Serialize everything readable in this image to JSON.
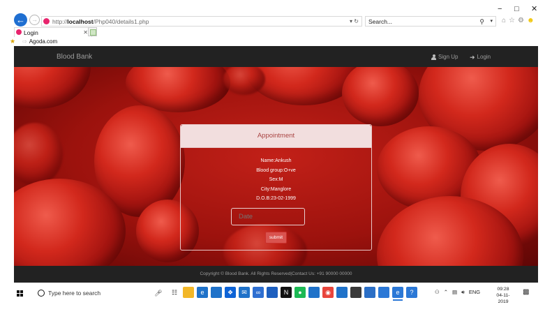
{
  "browser": {
    "url_prefix": "http://",
    "url_host": "localhost",
    "url_path": "/Php040/details1.php",
    "search_placeholder": "Search...",
    "tab_label": "Login",
    "favorites_link": "Agoda.com",
    "window_controls": [
      "−",
      "□",
      "✕"
    ]
  },
  "site": {
    "brand": "Blood Bank",
    "nav": {
      "signup": "Sign Up",
      "login": "Login"
    },
    "appointment": {
      "title": "Appointment",
      "details": {
        "name": "Name:Ankush",
        "blood_group": "Blood group:O+ve",
        "sex": "Sex:M",
        "city": "City:Manglore",
        "dob": "D.O.B:23-02-1999"
      },
      "date_placeholder": "Date",
      "submit_label": "submit"
    },
    "footer": "Copyright © Blood Bank. All Rights Reserved|Contact Us: +91 90000 00000"
  },
  "taskbar": {
    "search_placeholder": "Type here to search",
    "language": "ENG",
    "time": "09:28",
    "date": "04-11-2019",
    "apps": [
      {
        "icon": "task-view-icon",
        "color": "#ffffff",
        "glyph": "☷"
      },
      {
        "icon": "file-explorer-icon",
        "color": "#f2b728",
        "glyph": ""
      },
      {
        "icon": "edge-icon",
        "color": "#1f72c9",
        "glyph": "e"
      },
      {
        "icon": "store-icon",
        "color": "#1f72c9",
        "glyph": ""
      },
      {
        "icon": "dropbox-icon",
        "color": "#0d63d6",
        "glyph": "❖"
      },
      {
        "icon": "mail-icon",
        "color": "#1f72c9",
        "glyph": "✉"
      },
      {
        "icon": "infinity-icon",
        "color": "#2e6fd1",
        "glyph": "∞"
      },
      {
        "icon": "inbox-icon",
        "color": "#1d5fbf",
        "glyph": ""
      },
      {
        "icon": "netflix-icon",
        "color": "#111111",
        "glyph": "N"
      },
      {
        "icon": "spotify-icon",
        "color": "#1db954",
        "glyph": "●"
      },
      {
        "icon": "photos-icon",
        "color": "#1f72c9",
        "glyph": ""
      },
      {
        "icon": "chrome-icon",
        "color": "#e8453c",
        "glyph": "◉"
      },
      {
        "icon": "3d-icon",
        "color": "#1f72c9",
        "glyph": ""
      },
      {
        "icon": "sticky-icon",
        "color": "#3a3a3a",
        "glyph": ""
      },
      {
        "icon": "calendar-icon",
        "color": "#2b6fc6",
        "glyph": ""
      },
      {
        "icon": "paint-icon",
        "color": "#2b78d6",
        "glyph": ""
      },
      {
        "icon": "ie-icon",
        "color": "#2b78d6",
        "glyph": "e"
      },
      {
        "icon": "help-icon",
        "color": "#2b78d6",
        "glyph": "?"
      }
    ]
  }
}
